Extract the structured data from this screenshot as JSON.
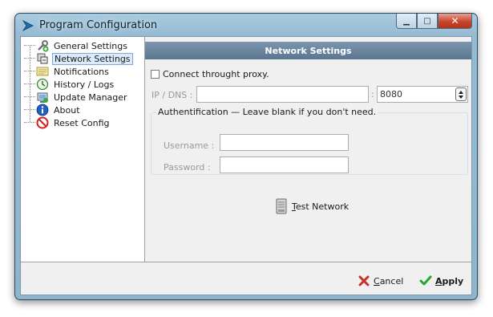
{
  "window": {
    "title": "Program Configuration",
    "minimize_glyph": "▁",
    "maximize_glyph": "□",
    "close_glyph": "✕"
  },
  "sidebar": {
    "items": [
      {
        "label": "General Settings",
        "icon": "settings-icon"
      },
      {
        "label": "Network Settings",
        "icon": "network-icon",
        "selected": true
      },
      {
        "label": "Notifications",
        "icon": "notifications-icon"
      },
      {
        "label": "History / Logs",
        "icon": "history-icon"
      },
      {
        "label": "Update Manager",
        "icon": "update-icon"
      },
      {
        "label": "About",
        "icon": "info-icon"
      },
      {
        "label": "Reset Config",
        "icon": "reset-icon"
      }
    ]
  },
  "network": {
    "header": "Network Settings",
    "proxy_checkbox_label": "Connect throught proxy.",
    "proxy_checked": false,
    "ip_label": "IP / DNS :",
    "ip_value": "",
    "port_separator": ":",
    "port_value": "8080",
    "auth_legend": "Authentification — Leave blank if you don't need.",
    "username_label": "Username :",
    "username_value": "",
    "password_label": "Password :",
    "password_value": "",
    "test_button_mnemonic": "T",
    "test_button_rest": "est Network"
  },
  "footer": {
    "cancel_mnemonic": "C",
    "cancel_rest": "ancel",
    "apply_mnemonic": "A",
    "apply_rest": "pply"
  },
  "colors": {
    "header_bg": "#5a7590",
    "cancel_icon": "#c8302a",
    "apply_icon": "#2aa62a",
    "title_bar": "#a9cbe0"
  }
}
